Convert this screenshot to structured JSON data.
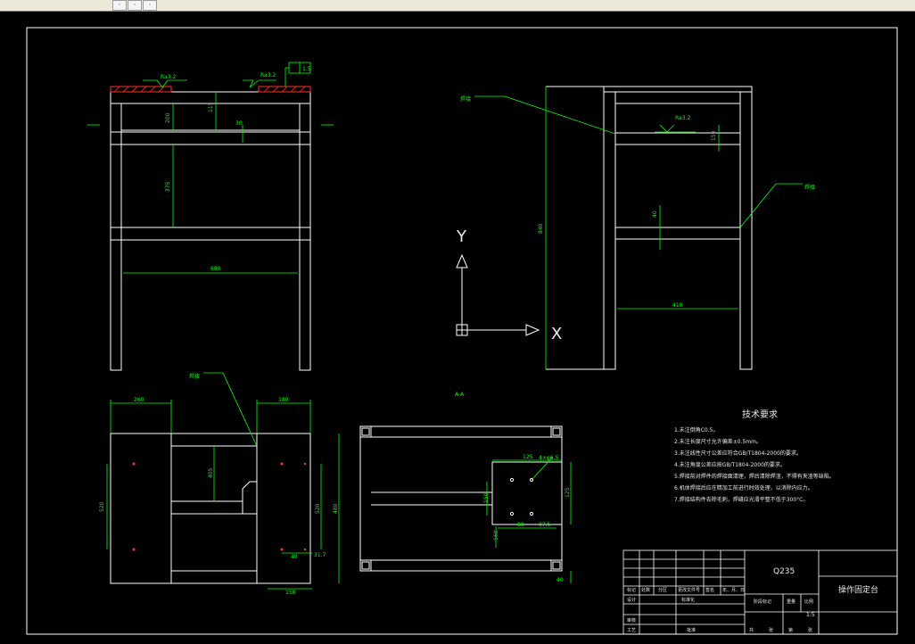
{
  "toolbar": {
    "buttons": [
      "·",
      "·",
      "·"
    ]
  },
  "drawing": {
    "tech_title": "技术要求",
    "tech_items": [
      "1.未注倒角C0.5。",
      "2.未注长度尺寸允许偏差±0.5mm。",
      "3.未注线性尺寸公差应符合GB/T1804-2000的要求。",
      "4.未注角度公差应按GB/T1804-2000的要求。",
      "5.焊接前对焊件的焊接面清理，焊后清除焊渣，不得有夹渣等缺陷。",
      "6.机体焊接后应在精加工前进行时效处理，以消除内应力。",
      "7.焊接结构件去除毛刺，焊缝应光滑平整不低于300°C。"
    ],
    "dims": {
      "front_width": "680",
      "front_upper": "200",
      "front_mid": "375",
      "front_top": "115",
      "front_small": "30",
      "side_height": "840",
      "side_width": "410",
      "side_gap": "40",
      "side_top": "150",
      "bottom_left_w": "260",
      "bottom_right_w": "180",
      "bottom_h": "520",
      "bottom_h2": "520",
      "bottom_h3": "480",
      "bottom_inner": "405",
      "bottom_small": "31.7",
      "bottom_a": "40",
      "bottom_b": "150",
      "plate_dim1": "4×φ6.5",
      "plate_dim2": "125",
      "plate_dim3": "150",
      "plate_dim4": "125",
      "plate_dim5": "160",
      "plate_dim6": "40",
      "plate_dim7": "80",
      "plate_dim8": "37.5"
    },
    "roughness": [
      "Ra3.2",
      "Ra3.2",
      "Ra3.2"
    ],
    "tolerance_box": "1.5",
    "weld_labels": [
      "焊接",
      "焊接",
      "焊接"
    ],
    "section_label": "A-A",
    "ucs": {
      "x": "X",
      "y": "Y"
    }
  },
  "title_block": {
    "material": "Q235",
    "part_name": "操作固定台",
    "cells": [
      "标记",
      "处数",
      "分区",
      "更改文件号",
      "签名",
      "年、月、日",
      "设计",
      "标准化",
      "审核",
      "工艺",
      "批准",
      "阶段标记",
      "重量",
      "比例",
      "共",
      "张",
      "第",
      "张"
    ],
    "scale": "1:5"
  }
}
